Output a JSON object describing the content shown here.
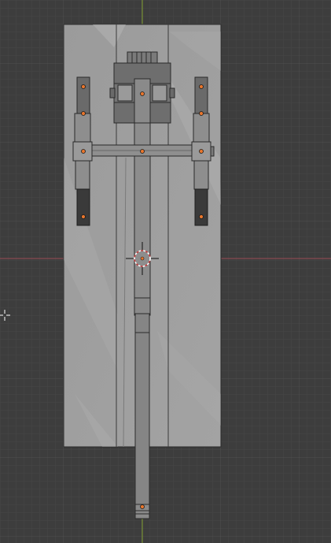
{
  "viewport": {
    "mode": "top-orthographic",
    "background": "#3d3d3d",
    "grid_minor": "#444444",
    "grid_major": "#4a4a4a",
    "x_axis_color": "#9b4a55",
    "y_axis_color": "#7d9a2b",
    "cursor_3d_color": "#c53b3b",
    "origin_color": "#e8762d"
  },
  "scene": {
    "objects": [
      {
        "name": "plane",
        "color": "#9a9a9a"
      },
      {
        "name": "center-beam",
        "color": "#8a8a8a"
      },
      {
        "name": "cross-beam",
        "color": "#8f8f8f"
      },
      {
        "name": "front-hub",
        "color": "#6e6e6e"
      },
      {
        "name": "left-arm",
        "color": "#6a6a6a"
      },
      {
        "name": "right-arm",
        "color": "#6a6a6a"
      },
      {
        "name": "tail-extension",
        "color": "#7f7f7f"
      }
    ]
  }
}
